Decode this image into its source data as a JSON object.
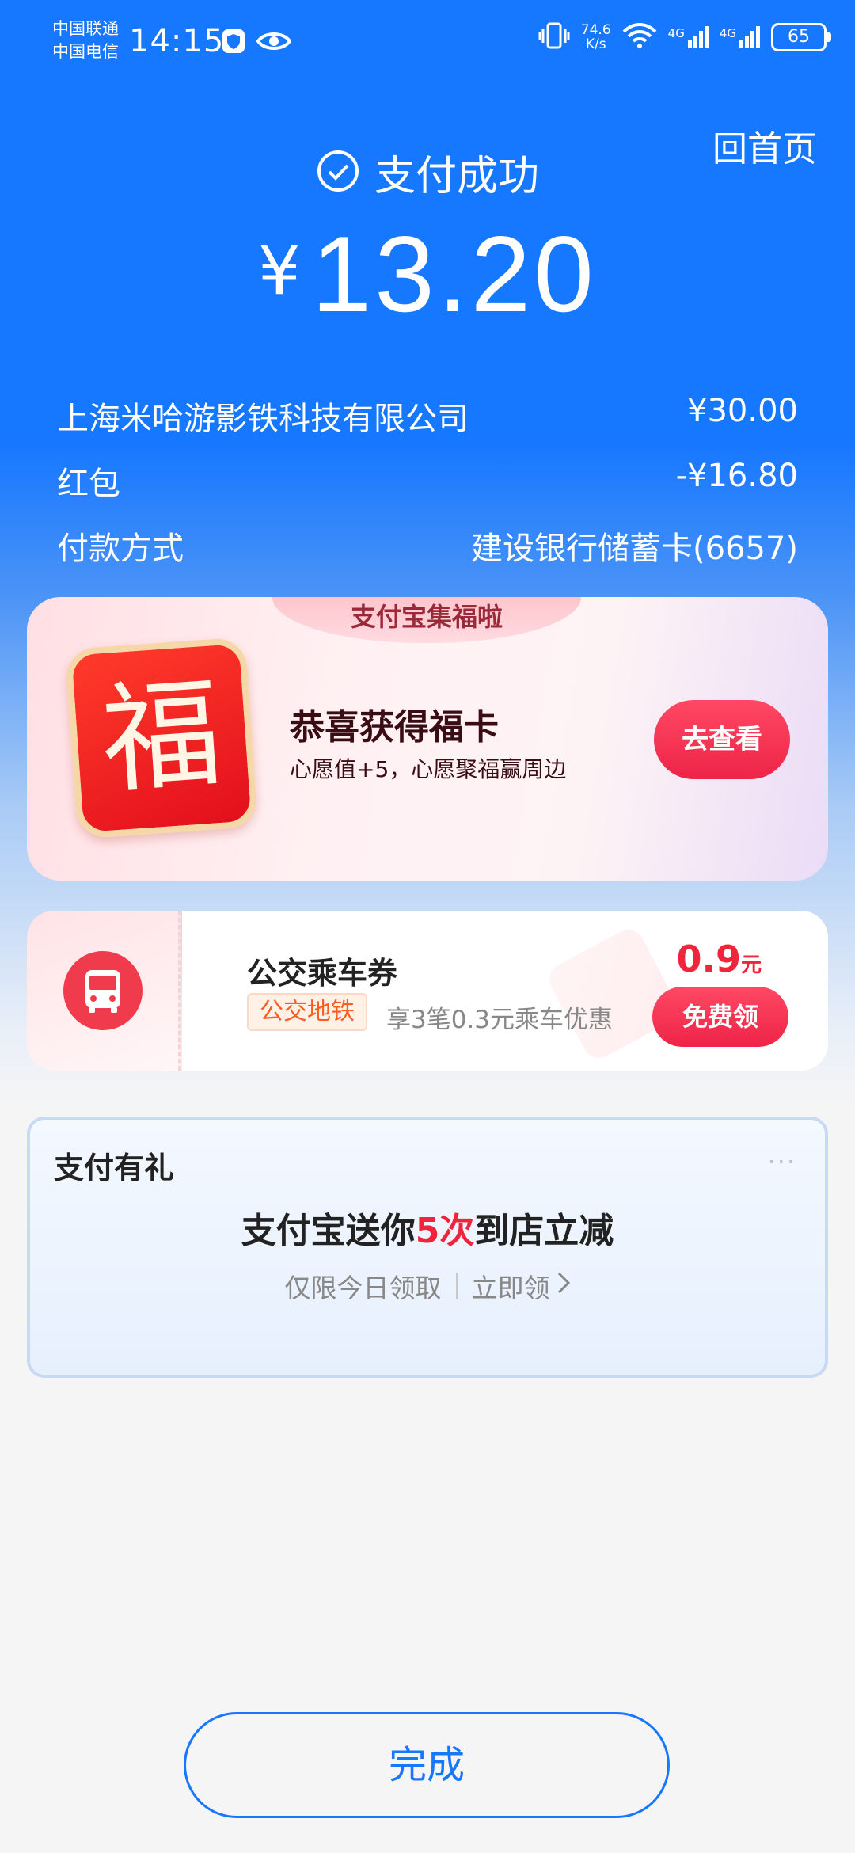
{
  "status_bar": {
    "carrier_1": "中国联通",
    "carrier_2": "中国电信",
    "time": "14:15",
    "net_speed_value": "74.6",
    "net_speed_unit": "K/s",
    "signal_1_label": "4G",
    "signal_2_label": "4G",
    "battery": "65"
  },
  "header": {
    "home_link": "回首页",
    "success_title": "支付成功",
    "amount_symbol": "¥",
    "amount": "13.20"
  },
  "details": [
    {
      "label": "上海米哈游影铁科技有限公司",
      "value": "¥30.00"
    },
    {
      "label": "红包",
      "value": "-¥16.80"
    },
    {
      "label": "付款方式",
      "value": "建设银行储蓄卡(6657)"
    }
  ],
  "blessing_card": {
    "ribbon": "支付宝集福啦",
    "tile_char": "福",
    "title": "恭喜获得福卡",
    "subtitle": "心愿值+5，心愿聚福赢周边",
    "button": "去查看"
  },
  "bus_card": {
    "title": "公交乘车券",
    "tag": "公交地铁",
    "description": "享3笔0.3元乘车优惠",
    "price": "0.9",
    "price_unit": "元",
    "button": "免费领"
  },
  "promo_card": {
    "label": "支付有礼",
    "more": "···",
    "title_prefix": "支付宝送你",
    "title_highlight": "5次",
    "title_suffix": "到店立减",
    "sub_left": "仅限今日领取",
    "sub_right": "立即领"
  },
  "footer": {
    "done_button": "完成"
  },
  "colors": {
    "brand_blue": "#1677ff",
    "accent_red": "#f0243c",
    "tag_orange": "#ff5c1f"
  }
}
